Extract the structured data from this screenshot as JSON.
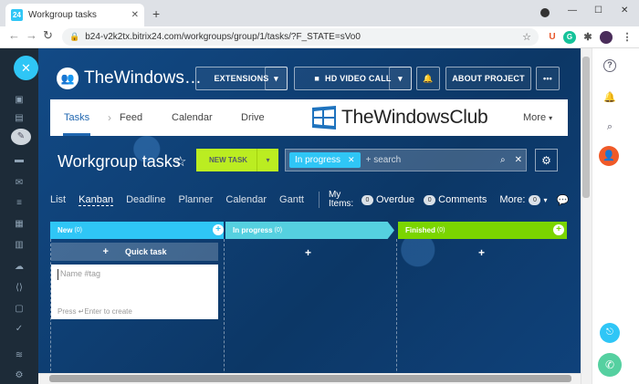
{
  "browser": {
    "tab_title": "Workgroup tasks",
    "favicon_text": "24",
    "url": "b24-v2k2tx.bitrix24.com/workgroups/group/1/tasks/?F_STATE=sVo0"
  },
  "header": {
    "portal_name": "TheWindows…",
    "extensions_label": "EXTENSIONS",
    "video_call_label": "HD VIDEO CALL",
    "about_project_label": "ABOUT PROJECT",
    "more_icon": "•••"
  },
  "nav": {
    "tasks": "Tasks",
    "feed": "Feed",
    "calendar": "Calendar",
    "drive": "Drive",
    "more": "More",
    "logo_text": "TheWindowsClub"
  },
  "title_row": {
    "page_title": "Workgroup tasks",
    "new_task_label": "NEW TASK",
    "filter_chip": "In progress",
    "search_placeholder": "+ search"
  },
  "views": {
    "list": "List",
    "kanban": "Kanban",
    "deadline": "Deadline",
    "planner": "Planner",
    "calendar": "Calendar",
    "gantt": "Gantt",
    "my_items": "My Items:",
    "overdue_count": "0",
    "overdue": "Overdue",
    "comments_count": "0",
    "comments": "Comments",
    "more": "More:",
    "more_count": "0"
  },
  "kanban": {
    "columns": [
      {
        "title": "New",
        "count": "(0)",
        "color": "#2fc6f6"
      },
      {
        "title": "In progress",
        "count": "(0)",
        "color": "#55d0e0"
      },
      {
        "title": "Finished",
        "count": "(0)",
        "color": "#7bd500"
      }
    ],
    "quick_task_label": "Quick task",
    "card_placeholder": "Name #tag",
    "card_hint": "Press ↵Enter to create"
  },
  "colors": {
    "accent": "#2fc6f6",
    "new_task_button": "#bbed21",
    "background": "#0d3a6e"
  }
}
